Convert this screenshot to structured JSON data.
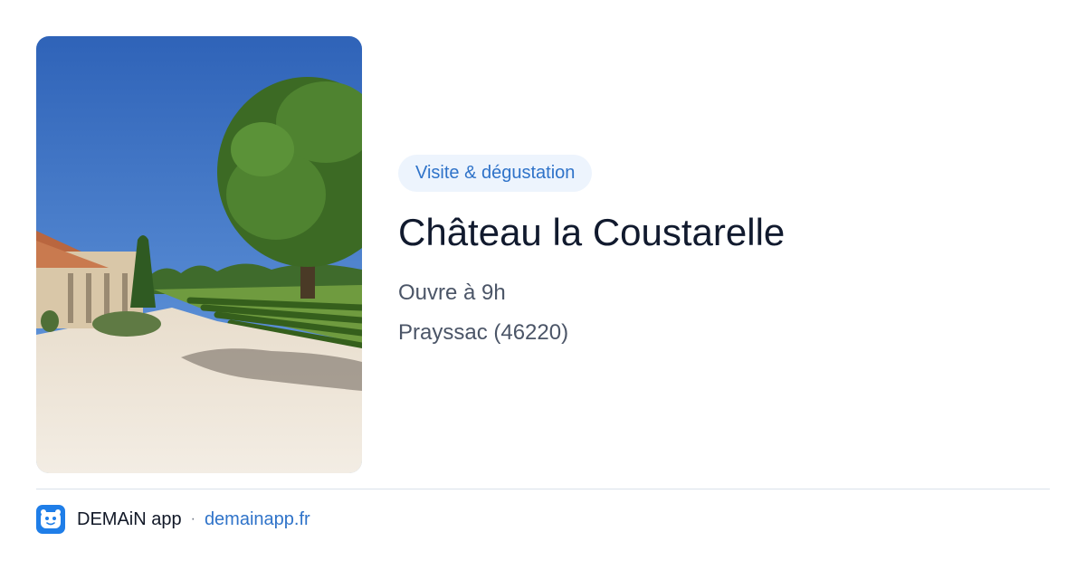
{
  "card": {
    "category": "Visite & dégustation",
    "name": "Château la Coustarelle",
    "hours": "Ouvre à 9h",
    "location": "Prayssac (46220)"
  },
  "photo": {
    "subject": "vineyard-estate-photo"
  },
  "footer": {
    "app_name": "DEMAiN app",
    "separator": "·",
    "site": "demainapp.fr"
  },
  "colors": {
    "accent": "#2f73c9",
    "badge_bg": "#edf4fd",
    "title": "#111a2e",
    "meta": "#4b5567",
    "divider": "#d9e2ea",
    "logo_bg": "#1f7ee8"
  },
  "icons": {
    "app_logo": "mascot-app-icon"
  }
}
